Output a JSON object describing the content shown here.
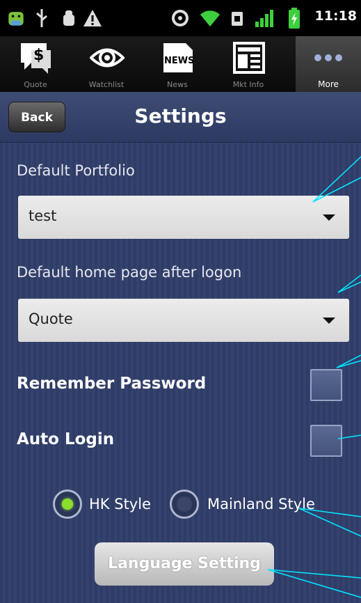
{
  "status_bar": {
    "time": "11:18",
    "icons": [
      "android-icon",
      "usb-icon",
      "debug-icon",
      "warning-icon",
      "sync-icon",
      "wifi-icon",
      "sim-icon",
      "signal-icon",
      "battery-icon"
    ]
  },
  "tabs": [
    {
      "label": "Quote",
      "icon": "quote-icon",
      "active": false
    },
    {
      "label": "Watchlist",
      "icon": "eye-icon",
      "active": false
    },
    {
      "label": "News",
      "icon": "news-icon",
      "icon_text": "NEWS",
      "active": false
    },
    {
      "label": "Mkt Info",
      "icon": "mkt-info-icon",
      "active": false
    },
    {
      "label": "More",
      "icon": "more-dots-icon",
      "active": true
    }
  ],
  "header": {
    "back_label": "Back",
    "title": "Settings"
  },
  "settings": {
    "portfolio": {
      "label": "Default Portfolio",
      "value": "test"
    },
    "home_page": {
      "label": "Default home page after logon",
      "value": "Quote"
    },
    "remember_password": {
      "label": "Remember Password",
      "checked": false
    },
    "auto_login": {
      "label": "Auto Login",
      "checked": false
    },
    "style": {
      "hk_label": "HK Style",
      "mainland_label": "Mainland Style",
      "selected": "HK Style"
    },
    "language_button": "Language Setting"
  },
  "colors": {
    "background": "#2e3b63",
    "annotation": "#00e5ff",
    "radio_selected": "#8adf2a"
  }
}
